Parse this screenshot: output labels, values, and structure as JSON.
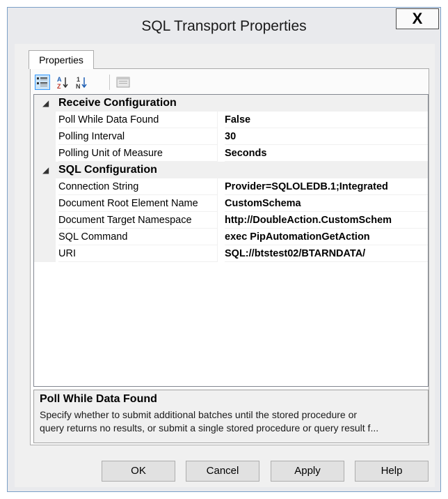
{
  "window": {
    "title": "SQL Transport Properties",
    "close_label": "X"
  },
  "tab": {
    "label": "Properties"
  },
  "toolbar": {
    "buttons": [
      {
        "name": "categorized",
        "icon": "categorized-view-icon"
      },
      {
        "name": "alphabetical",
        "icon": "sort-alphabetical-icon"
      },
      {
        "name": "sort-numeric",
        "icon": "sort-numeric-icon"
      },
      {
        "name": "property-pages",
        "icon": "property-pages-icon"
      }
    ]
  },
  "grid": {
    "categories": [
      {
        "name": "Receive Configuration",
        "expander": "◢",
        "properties": [
          {
            "name": "Poll While Data Found",
            "value": "False"
          },
          {
            "name": "Polling Interval",
            "value": "30"
          },
          {
            "name": "Polling Unit of Measure",
            "value": "Seconds"
          }
        ]
      },
      {
        "name": "SQL Configuration",
        "expander": "◢",
        "properties": [
          {
            "name": "Connection String",
            "value": "Provider=SQLOLEDB.1;Integrated"
          },
          {
            "name": "Document Root Element Name",
            "value": "CustomSchema"
          },
          {
            "name": "Document Target Namespace",
            "value": "http://DoubleAction.CustomSchem"
          },
          {
            "name": "SQL Command",
            "value": "exec PipAutomationGetAction"
          },
          {
            "name": "URI",
            "value": "SQL://btstest02/BTARNDATA/"
          }
        ]
      }
    ]
  },
  "description": {
    "title": "Poll While Data Found",
    "text_line1": "Specify whether to submit additional batches until the stored procedure or",
    "text_line2": "query returns no results, or submit a single stored procedure or query result f..."
  },
  "buttons": {
    "ok": "OK",
    "cancel": "Cancel",
    "apply": "Apply",
    "help": "Help"
  }
}
